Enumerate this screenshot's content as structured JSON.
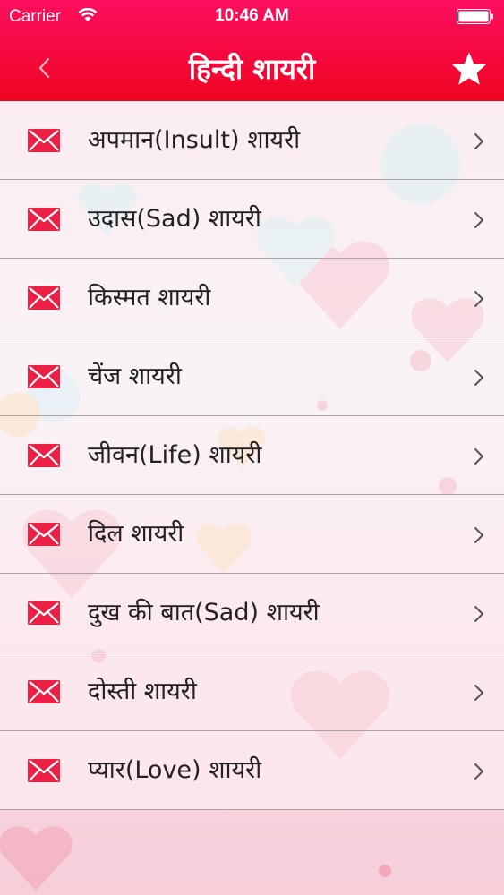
{
  "status_bar": {
    "carrier": "Carrier",
    "time": "10:46 AM"
  },
  "nav": {
    "title": "हिन्दी शायरी",
    "back_icon": "chevron-left-icon",
    "favorite_icon": "star-icon"
  },
  "colors": {
    "header_top": "#fb0f5f",
    "header_bottom": "#ef061f",
    "icon_red": "#ec1f45",
    "separator": "#a9a3a6"
  },
  "categories": [
    {
      "label": "अपमान(Insult) शायरी",
      "icon": "envelope-icon"
    },
    {
      "label": "उदास(Sad) शायरी",
      "icon": "envelope-icon"
    },
    {
      "label": "किस्मत शायरी",
      "icon": "envelope-icon"
    },
    {
      "label": "चेंज शायरी",
      "icon": "envelope-icon"
    },
    {
      "label": "जीवन(Life) शायरी",
      "icon": "envelope-icon"
    },
    {
      "label": "दिल शायरी",
      "icon": "envelope-icon"
    },
    {
      "label": "दुख की बात(Sad) शायरी",
      "icon": "envelope-icon"
    },
    {
      "label": "दोस्ती शायरी",
      "icon": "envelope-icon"
    },
    {
      "label": "प्यार(Love) शायरी",
      "icon": "envelope-icon"
    }
  ]
}
